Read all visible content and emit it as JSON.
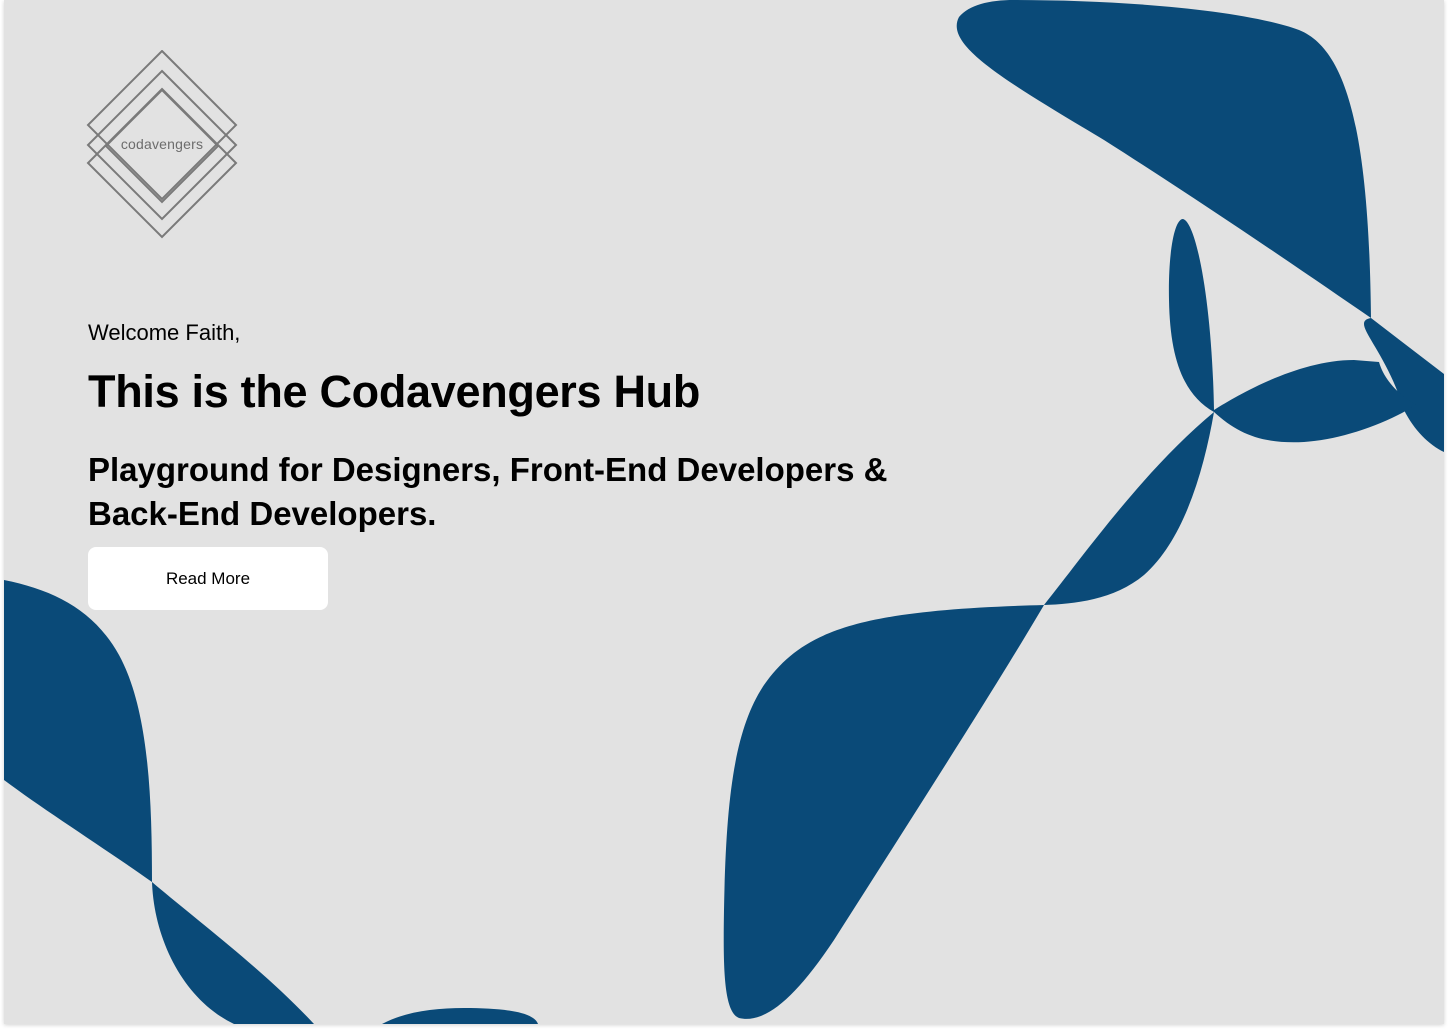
{
  "brand": {
    "logo_text": "codavengers"
  },
  "hero": {
    "welcome": "Welcome Faith,",
    "title": "This is the Codavengers Hub",
    "subtitle": "Playground for Designers, Front-End Developers & Back-End Developers.",
    "cta_label": "Read More"
  },
  "colors": {
    "background": "#e2e2e2",
    "accent_shape": "#0a4a78",
    "button_bg": "#ffffff",
    "text": "#000000",
    "logo_stroke": "#7a7a7a"
  }
}
